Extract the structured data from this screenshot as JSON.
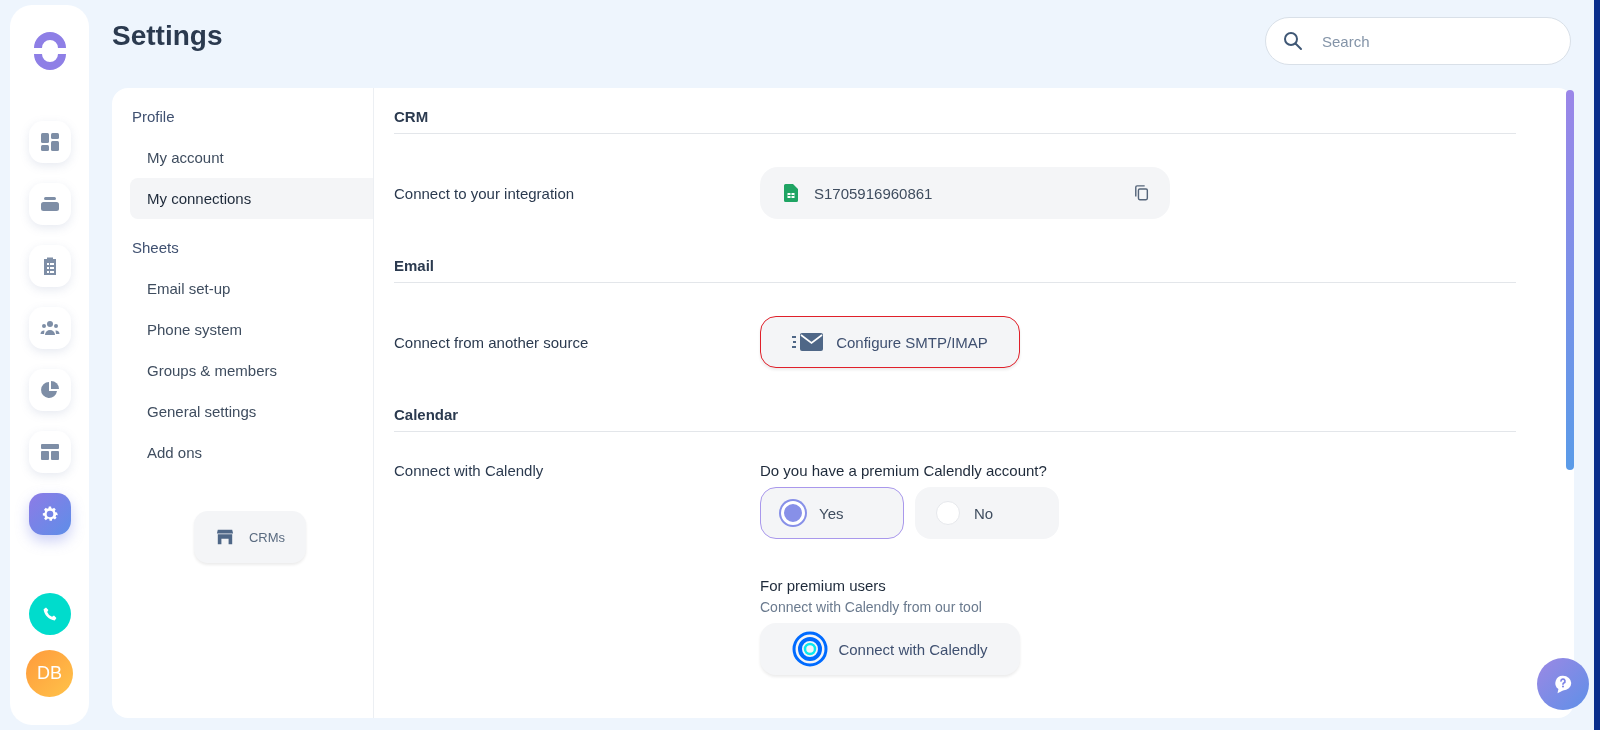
{
  "rail": {
    "items": [
      {
        "kind": "dashboard",
        "selected": false
      },
      {
        "kind": "inbox",
        "selected": false
      },
      {
        "kind": "clipboard",
        "selected": false
      },
      {
        "kind": "team",
        "selected": false
      },
      {
        "kind": "pie",
        "selected": false
      },
      {
        "kind": "layout",
        "selected": false
      },
      {
        "kind": "settings",
        "selected": true
      }
    ],
    "avatar": "DB"
  },
  "page_title": "Settings",
  "search": {
    "placeholder": "Search"
  },
  "settings_nav": {
    "groups": [
      {
        "title": "Profile",
        "items": [
          {
            "label": "My account",
            "selected": false
          },
          {
            "label": "My connections",
            "selected": true
          }
        ]
      },
      {
        "title": "Sheets",
        "items": [
          {
            "label": "Email set-up",
            "selected": false
          },
          {
            "label": "Phone system",
            "selected": false
          },
          {
            "label": "Groups & members",
            "selected": false
          },
          {
            "label": "General settings",
            "selected": false
          },
          {
            "label": "Add ons",
            "selected": false
          }
        ]
      }
    ],
    "crm_button": "CRMs"
  },
  "sections": [
    {
      "title": "CRM",
      "rows": [
        {
          "kind": "field",
          "label": "Connect to your integration",
          "value": "S1705916960861"
        }
      ]
    },
    {
      "title": "Email",
      "rows": [
        {
          "kind": "button",
          "label": "Connect from another source",
          "button": "Configure SMTP/IMAP",
          "highlighted": true
        }
      ]
    },
    {
      "title": "Calendar",
      "rows": [
        {
          "kind": "calendly",
          "label": "Connect with Calendly",
          "question": "Do you have a premium Calendly account?",
          "options": [
            {
              "label": "Yes",
              "selected": true
            },
            {
              "label": "No",
              "selected": false
            }
          ],
          "premium_title": "For premium users",
          "premium_subtitle": "Connect with Calendly from our tool",
          "button": "Connect with Calendly"
        }
      ]
    }
  ]
}
